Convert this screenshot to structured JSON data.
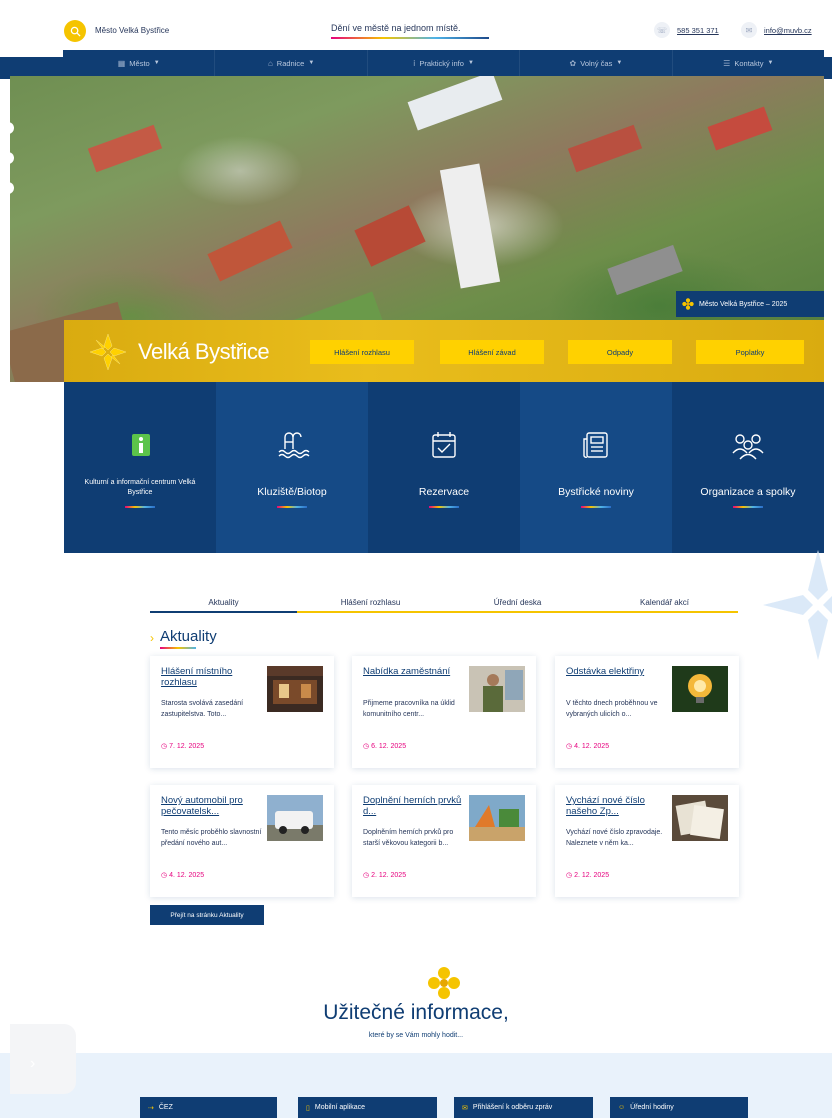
{
  "header": {
    "town_name": "Město Velká Bystřice",
    "slogan": "Dění ve městě na jednom místě.",
    "phone": "585 351 371",
    "email": "info@muvb.cz"
  },
  "nav": [
    {
      "label": "Město",
      "icon": "buildings-icon"
    },
    {
      "label": "Radnice",
      "icon": "town-hall-icon"
    },
    {
      "label": "Praktický info",
      "icon": "info-icon"
    },
    {
      "label": "Volný čas",
      "icon": "leisure-icon"
    },
    {
      "label": "Kontakty",
      "icon": "contacts-icon"
    }
  ],
  "hero": {
    "credit": "Město Velká Bystřice – 2025",
    "logo_text": "Velká Bystřice",
    "quick_links": [
      "Hlášení rozhlasu",
      "Hlášení závad",
      "Odpady",
      "Poplatky"
    ]
  },
  "tiles": [
    {
      "label": "Kulturní a informační centrum Velká Bystřice",
      "icon": "info-i-icon"
    },
    {
      "label": "Kluziště/Biotop",
      "icon": "pool-icon"
    },
    {
      "label": "Rezervace",
      "icon": "calendar-check-icon"
    },
    {
      "label": "Bystřické noviny",
      "icon": "newspaper-icon"
    },
    {
      "label": "Organizace a spolky",
      "icon": "people-icon"
    }
  ],
  "tabs": [
    "Aktuality",
    "Hlášení rozhlasu",
    "Úřední deska",
    "Kalendář akcí"
  ],
  "news": {
    "title": "Aktuality",
    "items": [
      {
        "title": "Hlášení místního rozhlasu",
        "text": "Starosta svolává zasedání zastupitelstva. Toto...",
        "date": "7. 12. 2025"
      },
      {
        "title": "Nabídka zaměstnání",
        "text": "Přijmeme pracovníka na úklid komunitního centr...",
        "date": "6. 12. 2025"
      },
      {
        "title": "Odstávka elektřiny",
        "text": "V těchto dnech proběhnou ve vybraných ulicích o...",
        "date": "4. 12. 2025"
      },
      {
        "title": "Nový automobil pro pečovatelsk...",
        "text": "Tento měsíc proběhlo slavnostní předání nového aut...",
        "date": "4. 12. 2025"
      },
      {
        "title": "Doplnění herních prvků d...",
        "text": "Doplněním herních prvků pro starší věkovou kategorii b...",
        "date": "2. 12. 2025"
      },
      {
        "title": "Vychází nové číslo našeho Zp...",
        "text": "Vychází nové číslo zpravodaje. Naleznete v něm ka...",
        "date": "2. 12. 2025"
      }
    ],
    "more_label": "Přejít na stránku Aktuality"
  },
  "useful": {
    "title": "Užitečné informace,",
    "subtitle": "které by se Vám mohly hodit...",
    "buttons": [
      "ČEZ",
      "Mobilní aplikace",
      "Přihlášení k odběru zpráv",
      "Úřední hodiny"
    ]
  },
  "colors": {
    "navy": "#0f3d73",
    "yellow": "#ffd100",
    "magenta": "#e6007e"
  }
}
